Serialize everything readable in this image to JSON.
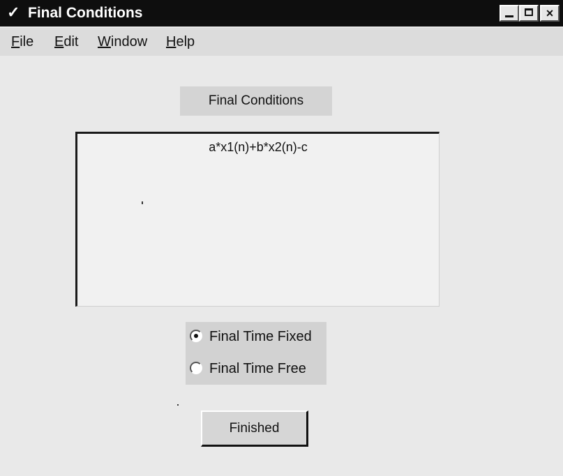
{
  "window": {
    "title": "Final Conditions",
    "title_icon": "check-icon",
    "controls": {
      "minimize": "minimize",
      "maximize": "maximize",
      "close": "×"
    }
  },
  "menu": {
    "items": [
      {
        "label_first": "F",
        "label_rest": "ile"
      },
      {
        "label_first": "E",
        "label_rest": "dit"
      },
      {
        "label_first": "W",
        "label_rest": "indow"
      },
      {
        "label_first": "H",
        "label_rest": "elp"
      }
    ]
  },
  "main": {
    "heading": "Final Conditions",
    "expression": "a*x1(n)+b*x2(n)-c"
  },
  "radio_group": {
    "options": [
      {
        "label": "Final Time Fixed",
        "selected": true
      },
      {
        "label": "Final Time Free",
        "selected": false
      }
    ]
  },
  "finished_button": {
    "label": "Finished"
  },
  "colors": {
    "titlebar": "#0e0e0e",
    "window_bg": "#e9e9e9",
    "panel_bg": "#d4d4d4"
  }
}
